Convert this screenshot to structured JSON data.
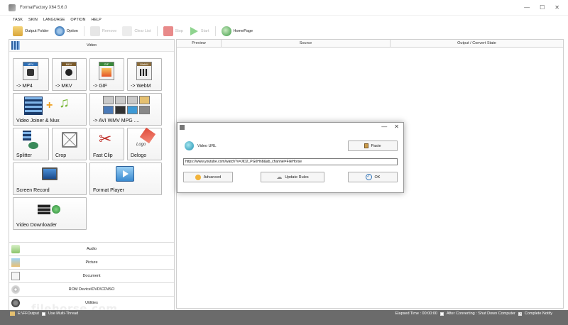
{
  "window": {
    "title": "FormatFactory X64 5.6.0",
    "controls": [
      "—",
      "☐",
      "✕"
    ]
  },
  "menu": [
    "TASK",
    "SKIN",
    "LANGUAGE",
    "OPTION",
    "HELP"
  ],
  "toolbar": {
    "output_folder": "Output Folder",
    "option": "Option",
    "remove": "Remove",
    "clear_list": "Clear List",
    "stop": "Stop",
    "start": "Start",
    "homepage": "HomePage"
  },
  "left": {
    "video_header": "Video",
    "tiles": {
      "mp4": "-> MP4",
      "mkv": "-> MKV",
      "gif": "-> GIF",
      "webm": "-> WebM",
      "joiner": "Video Joiner & Mux",
      "avi": "-> AVI WMV MPG ....",
      "splitter": "Splitter",
      "crop": "Crop",
      "fastclip": "Fast Clip",
      "delogo": "Delogo",
      "screenrecord": "Screen Record",
      "formatplayer": "Format Player",
      "downloader": "Video Downloader"
    },
    "badges": {
      "mp4": "MP4",
      "mkv": "MKV",
      "gif": "GIF",
      "webm": "WebM",
      "logo": "Logo"
    },
    "categories": [
      "Audio",
      "Picture",
      "Document",
      "ROM Device\\DVD\\CD\\ISO",
      "Utilities"
    ]
  },
  "table": {
    "headers": [
      "Preview",
      "Source",
      "Output / Convert State"
    ]
  },
  "dialog": {
    "controls": [
      "—",
      "✕"
    ],
    "url_label": "Video URL",
    "paste": "Paste",
    "url_value": "https://www.youtube.com/watch?v=JID2_PG0Hn8&ab_channel=FileHorse",
    "advanced": "Advanced",
    "update_rules": "Update Rules",
    "ok": "OK"
  },
  "status": {
    "output_path": "E:\\FFOutput",
    "multi_thread": "Use Multi-Thread",
    "elapsed": "Elapsed Time : 00:00:00",
    "after_converting": "After Converting : Shut Down Computer",
    "complete_notify": "Complete Notify"
  },
  "watermark": "filehorse.com",
  "colors": {
    "statusbar": "#6b6b6b",
    "dialog_border": "#9a9a9a",
    "stop_red": "#e88a8a",
    "start_green": "#6cc36c"
  }
}
